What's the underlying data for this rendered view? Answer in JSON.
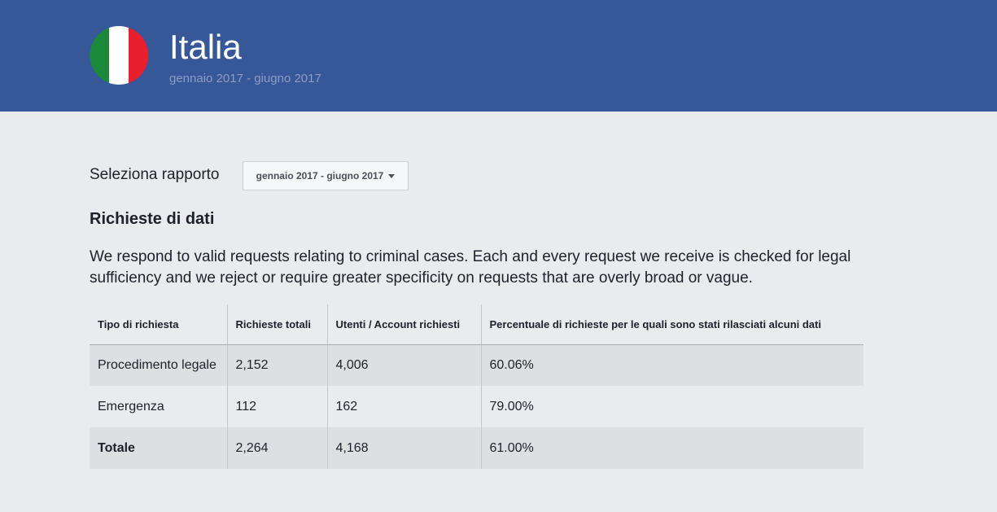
{
  "header": {
    "country": "Italia",
    "period": "gennaio 2017 - giugno 2017",
    "flag_colors": [
      "#1a8a3a",
      "#ffffff",
      "#e8202e"
    ],
    "background": "#365899"
  },
  "report_selector": {
    "label": "Seleziona rapporto",
    "selected": "gennaio 2017 - giugno 2017"
  },
  "section": {
    "title": "Richieste di dati",
    "description": "We respond to valid requests relating to criminal cases. Each and every request we receive is checked for legal sufficiency and we reject or require greater specificity on requests that are overly broad or vague."
  },
  "table": {
    "headers": [
      "Tipo di richiesta",
      "Richieste totali",
      "Utenti / Account richiesti",
      "Percentuale di richieste per le quali sono stati rilasciati alcuni dati"
    ],
    "rows": [
      [
        "Procedimento legale",
        "2,152",
        "4,006",
        "60.06%"
      ],
      [
        "Emergenza",
        "112",
        "162",
        "79.00%"
      ],
      [
        "Totale",
        "2,264",
        "4,168",
        "61.00%"
      ]
    ]
  }
}
